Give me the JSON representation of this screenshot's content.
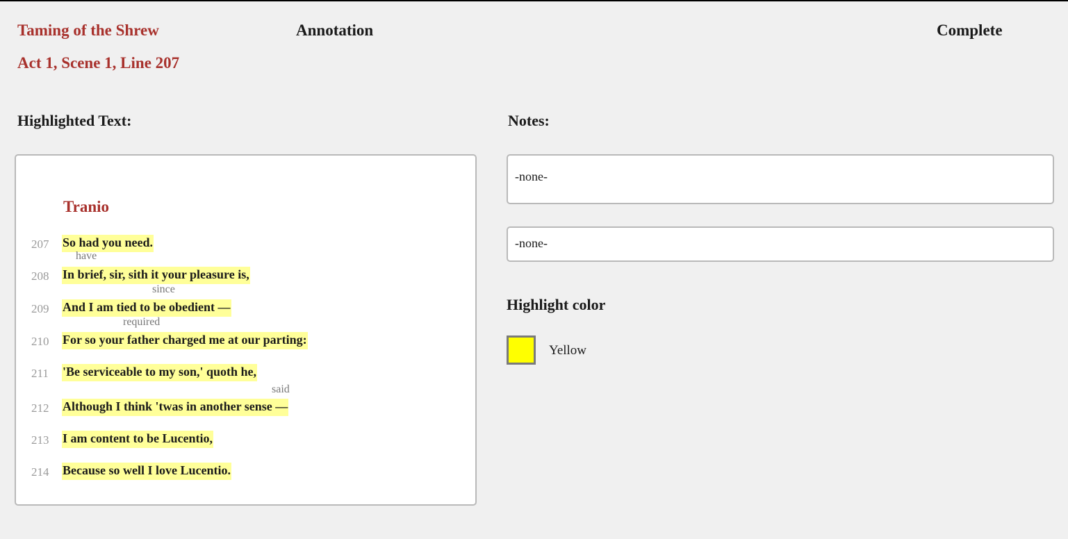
{
  "header": {
    "play_title": "Taming of the Shrew",
    "location": "Act 1, Scene 1, Line 207",
    "mode_label": "Annotation",
    "complete_label": "Complete"
  },
  "highlighted": {
    "heading": "Highlighted Text:",
    "speaker": "Tranio",
    "lines": [
      {
        "num": "207",
        "text": "So had you need.",
        "gloss": "have"
      },
      {
        "num": "208",
        "text": "In brief, sir, sith it your pleasure is,",
        "gloss": "since"
      },
      {
        "num": "209",
        "text": "And I am tied to be obedient —",
        "gloss": "required"
      },
      {
        "num": "210",
        "text": "For so your father charged me at our parting:",
        "gloss": ""
      },
      {
        "num": "211",
        "text": "'Be serviceable to my son,' quoth he,",
        "gloss": "said"
      },
      {
        "num": "212",
        "text": "Although I think 'twas in another sense —",
        "gloss": ""
      },
      {
        "num": "213",
        "text": "I am content to be Lucentio,",
        "gloss": ""
      },
      {
        "num": "214",
        "text": "Because so well I love Lucentio.",
        "gloss": ""
      }
    ]
  },
  "notes": {
    "heading": "Notes:",
    "note_1": "-none-",
    "note_2": "-none-"
  },
  "highlight_color": {
    "heading": "Highlight color",
    "selected_label": "Yellow",
    "selected_color": "#ffff00",
    "text_highlight_color": "#ffff99"
  },
  "colors": {
    "accent": "#a8312c",
    "background": "#f0f0f0"
  }
}
